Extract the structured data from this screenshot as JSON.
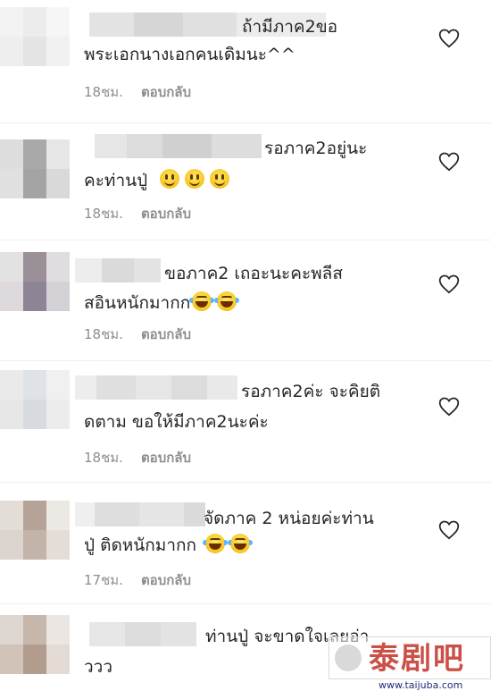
{
  "comments": [
    {
      "line1": "ถ้ามีภาค2ขอ",
      "line2": "พระเอกนางเอกคนเดิมนะ^^",
      "time": "18ชม.",
      "reply": "ตอบกลับ"
    },
    {
      "line1": "รอภาค2อยู่นะ",
      "line2": "คะท่านปู่",
      "time": "18ชม.",
      "reply": "ตอบกลับ",
      "emojis": [
        "smile",
        "smile",
        "smile"
      ]
    },
    {
      "line1": "ขอภาค2 เถอะนะคะพลีส",
      "line2": "สอินหนักมากก",
      "time": "18ชม.",
      "reply": "ตอบกลับ",
      "emojis": [
        "laugh-cry",
        "laugh-cry"
      ]
    },
    {
      "line1": "รอภาค2ค่ะ จะคิยติ",
      "line2": "ดตาม ขอให้มีภาค2นะค่ะ",
      "time": "18ชม.",
      "reply": "ตอบกลับ"
    },
    {
      "line1": "จัดภาค 2 หน่อยค่ะท่าน",
      "line2": "ปู่ ติดหนักมากก",
      "time": "17ชม.",
      "reply": "ตอบกลับ",
      "emojis": [
        "laugh-cry",
        "laugh-cry"
      ]
    },
    {
      "line1": "ท่านปู่ จะขาดใจเลยอ่า",
      "line2": "ววว"
    }
  ],
  "icons": {
    "like": "heart-outline-icon"
  },
  "watermark": {
    "brand": "泰剧吧",
    "url": "www.taijuba.com",
    "accent": "#c63f35"
  }
}
